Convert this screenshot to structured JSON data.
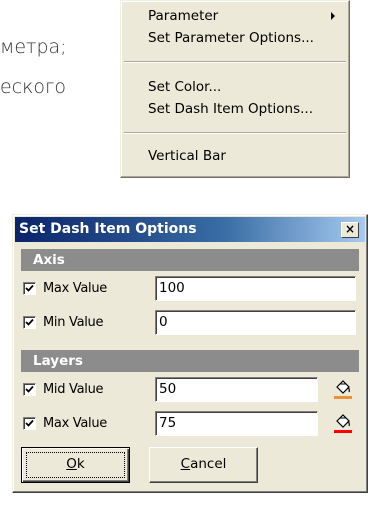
{
  "document": {
    "line1": "метра;",
    "line2": "еского"
  },
  "context_menu": {
    "items": [
      {
        "label": "Parameter",
        "has_submenu": true
      },
      {
        "label": "Set Parameter Options..."
      },
      {
        "label": "Set Color..."
      },
      {
        "label": "Set Dash Item Options..."
      },
      {
        "label": "Vertical Bar"
      }
    ]
  },
  "dialog": {
    "title": "Set Dash Item Options",
    "close_glyph": "×",
    "sections": {
      "axis": {
        "header": "Axis",
        "rows": [
          {
            "label": "Max Value",
            "checked": true,
            "value": "100"
          },
          {
            "label": "Min Value",
            "checked": true,
            "value": "0"
          }
        ]
      },
      "layers": {
        "header": "Layers",
        "rows": [
          {
            "label": "Mid Value",
            "checked": true,
            "value": "50",
            "color": "#e8903a",
            "icon": "paint-bucket-icon"
          },
          {
            "label": "Max Value",
            "checked": true,
            "value": "75",
            "color": "#ff0000",
            "icon": "paint-bucket-icon"
          }
        ]
      }
    },
    "buttons": {
      "ok": {
        "underline_char": "O",
        "rest": "k"
      },
      "cancel": {
        "underline_char": "C",
        "rest": "ancel"
      }
    }
  }
}
